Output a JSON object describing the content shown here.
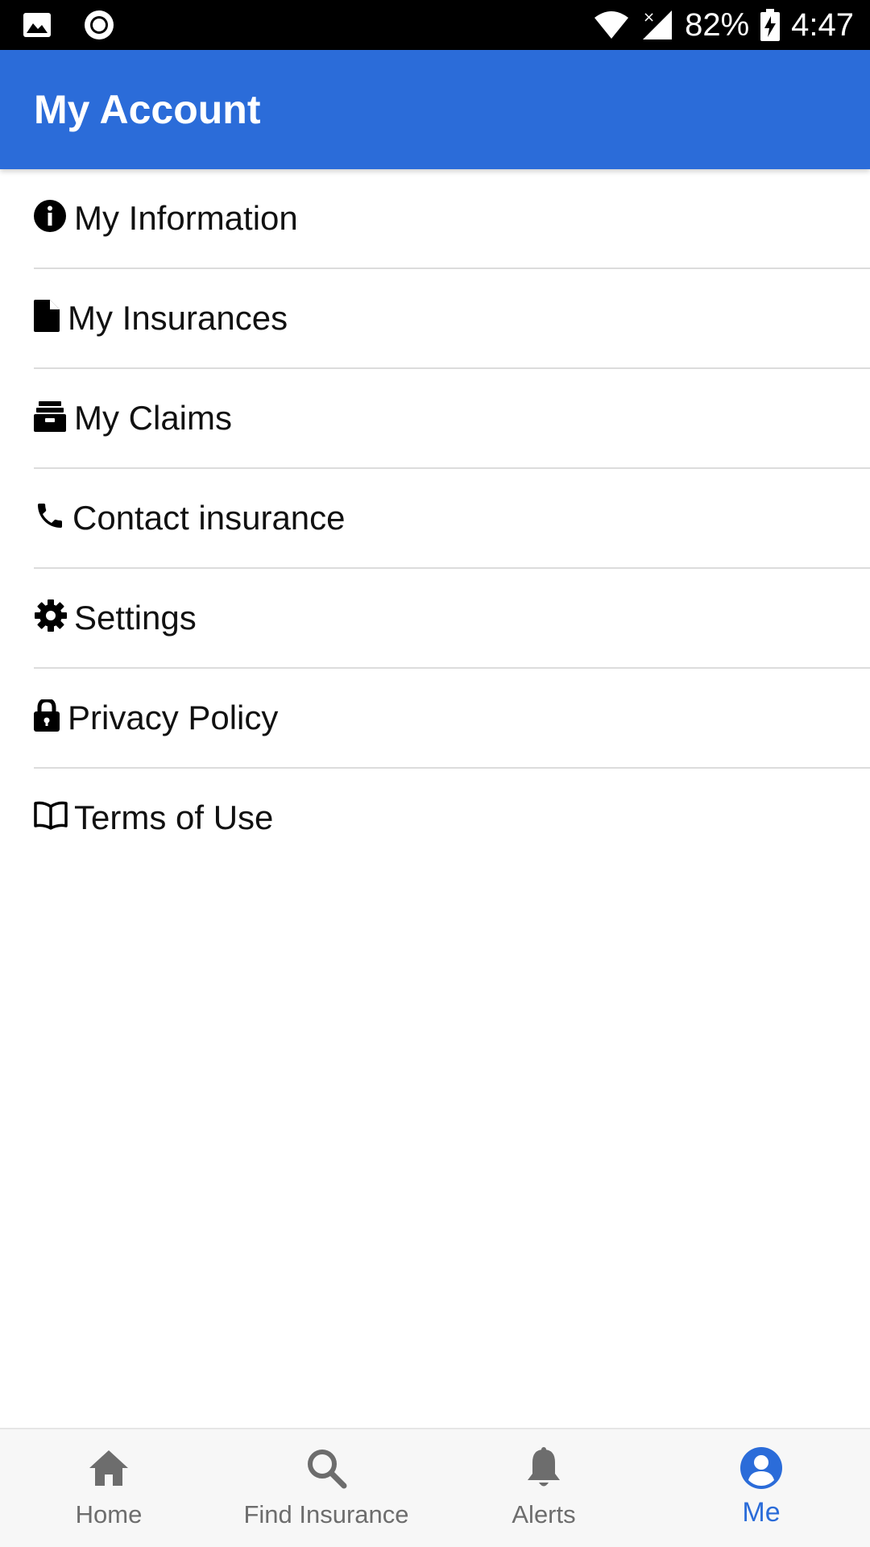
{
  "status_bar": {
    "battery": "82%",
    "time": "4:47",
    "icons": [
      "image-icon",
      "record-icon",
      "wifi-icon",
      "signal-icon",
      "battery-charging-icon"
    ]
  },
  "app_bar": {
    "title": "My Account"
  },
  "menu": {
    "items": [
      {
        "label": "My Information",
        "icon": "info-circle-icon"
      },
      {
        "label": "My Insurances",
        "icon": "file-icon"
      },
      {
        "label": "My Claims",
        "icon": "inbox-icon"
      },
      {
        "label": "Contact insurance",
        "icon": "phone-icon"
      },
      {
        "label": "Settings",
        "icon": "gear-icon"
      },
      {
        "label": "Privacy Policy",
        "icon": "lock-icon"
      },
      {
        "label": "Terms of Use",
        "icon": "book-icon"
      }
    ]
  },
  "bottom_nav": {
    "items": [
      {
        "label": "Home",
        "icon": "home-icon",
        "active": false
      },
      {
        "label": "Find Insurance",
        "icon": "search-icon",
        "active": false
      },
      {
        "label": "Alerts",
        "icon": "bell-icon",
        "active": false
      },
      {
        "label": "Me",
        "icon": "user-circle-icon",
        "active": true
      }
    ]
  },
  "colors": {
    "primary": "#2b6cd9",
    "inactive_nav": "#6d6d6d",
    "divider": "#dcdcdc"
  }
}
